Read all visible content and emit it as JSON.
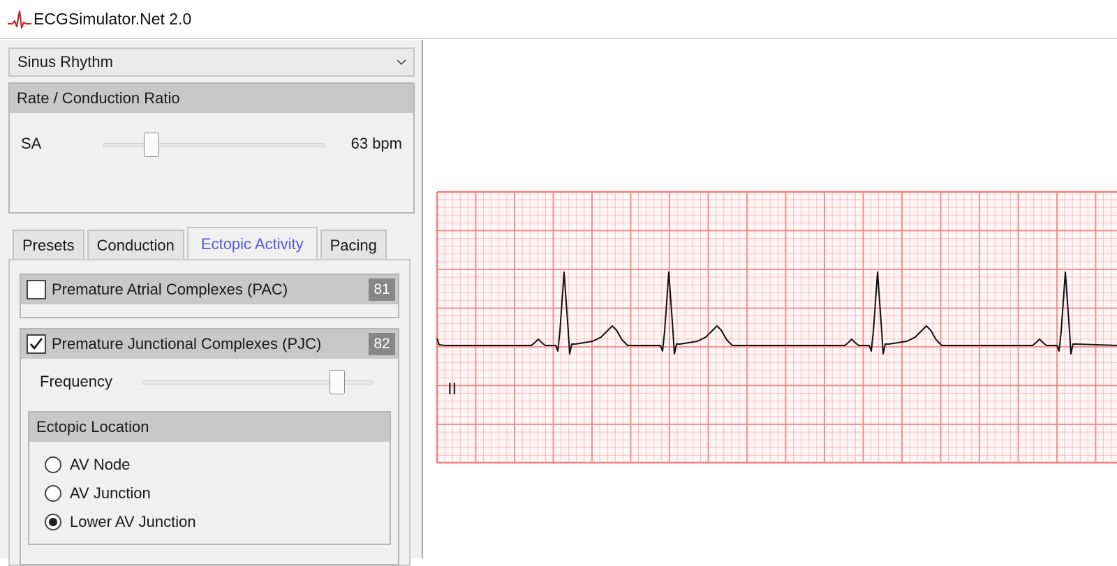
{
  "app": {
    "title": "ECGSimulator.Net 2.0",
    "icon": "ecg-waveform-icon"
  },
  "rhythm_select": {
    "value": "Sinus Rhythm",
    "icon": "chevron-down-icon"
  },
  "rate_panel": {
    "title": "Rate / Conduction Ratio",
    "sa_label": "SA",
    "sa_value": "63 bpm"
  },
  "tabs": [
    {
      "label": "Presets",
      "active": false
    },
    {
      "label": "Conduction",
      "active": false
    },
    {
      "label": "Ectopic Activity",
      "active": true
    },
    {
      "label": "Pacing",
      "active": false
    }
  ],
  "pac": {
    "label": "Premature Atrial Complexes (PAC)",
    "checked": false,
    "badge": "81"
  },
  "pjc": {
    "label": "Premature Junctional Complexes (PJC)",
    "checked": true,
    "badge": "82",
    "frequency_label": "Frequency",
    "frequency_level": 0.87
  },
  "ectopic_location": {
    "title": "Ectopic Location",
    "options": [
      {
        "label": "AV Node",
        "selected": false
      },
      {
        "label": "AV Junction",
        "selected": false
      },
      {
        "label": "Lower AV Junction",
        "selected": true
      }
    ]
  },
  "ecg": {
    "lead_label": "II",
    "grid_color": "#f08080",
    "trace_color": "#111111"
  },
  "colors": {
    "active_tab": "#5a5adc",
    "header_bg": "#c8c8c8",
    "badge_bg": "#878787"
  }
}
